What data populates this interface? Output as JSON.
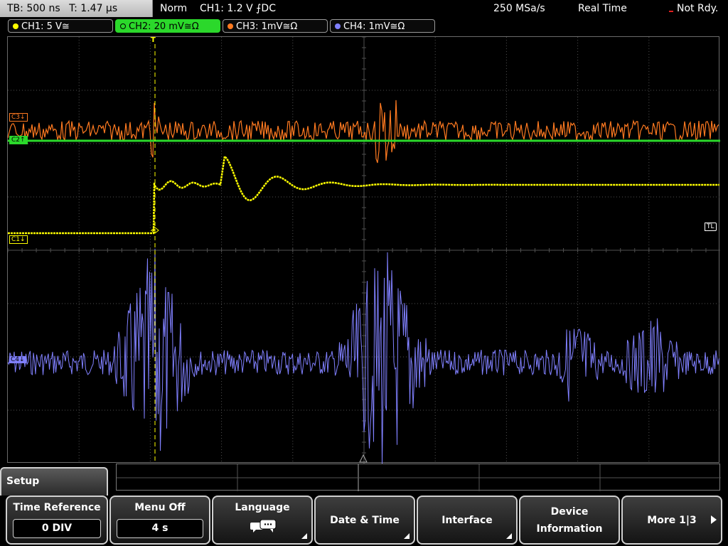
{
  "status": {
    "timebase": "TB: 500 ns",
    "trigger_time": "T: 1.47 µs",
    "mode": "Norm",
    "trigger": "CH1: 1.2 V ⨍DC",
    "sample_rate": "250 MSa/s",
    "acq_mode": "Real Time",
    "state": "Not Rdy."
  },
  "channels": [
    {
      "label": "CH1: 5 V≅",
      "color": "#ffff00"
    },
    {
      "label": "CH2: 20 mV≅Ω",
      "color": "#2bd82b",
      "active": true
    },
    {
      "label": "CH3: 1mV≅Ω",
      "color": "#ff7a20"
    },
    {
      "label": "CH4: 1mV≅Ω",
      "color": "#8080ff"
    }
  ],
  "markers": {
    "c3": "C3↓",
    "c2": "C2↑",
    "c1": "C1↓",
    "c4": "C4↓",
    "tl": "TL",
    "trigger": "T"
  },
  "menu": {
    "title": "Setup",
    "keys": [
      {
        "label": "Time Reference",
        "value": "0 DIV"
      },
      {
        "label": "Menu Off",
        "value": "4 s"
      },
      {
        "label": "Language",
        "icon": "speech-bubbles-icon"
      },
      {
        "label": "Date & Time"
      },
      {
        "label": "Interface"
      },
      {
        "label_line1": "Device",
        "label_line2": "Information"
      },
      {
        "label": "More 1|3"
      }
    ]
  },
  "colors": {
    "ch1": "#ffff00",
    "ch2": "#2bd82b",
    "ch3": "#ff7a20",
    "ch4": "#8080ff",
    "grid": "#505050"
  }
}
